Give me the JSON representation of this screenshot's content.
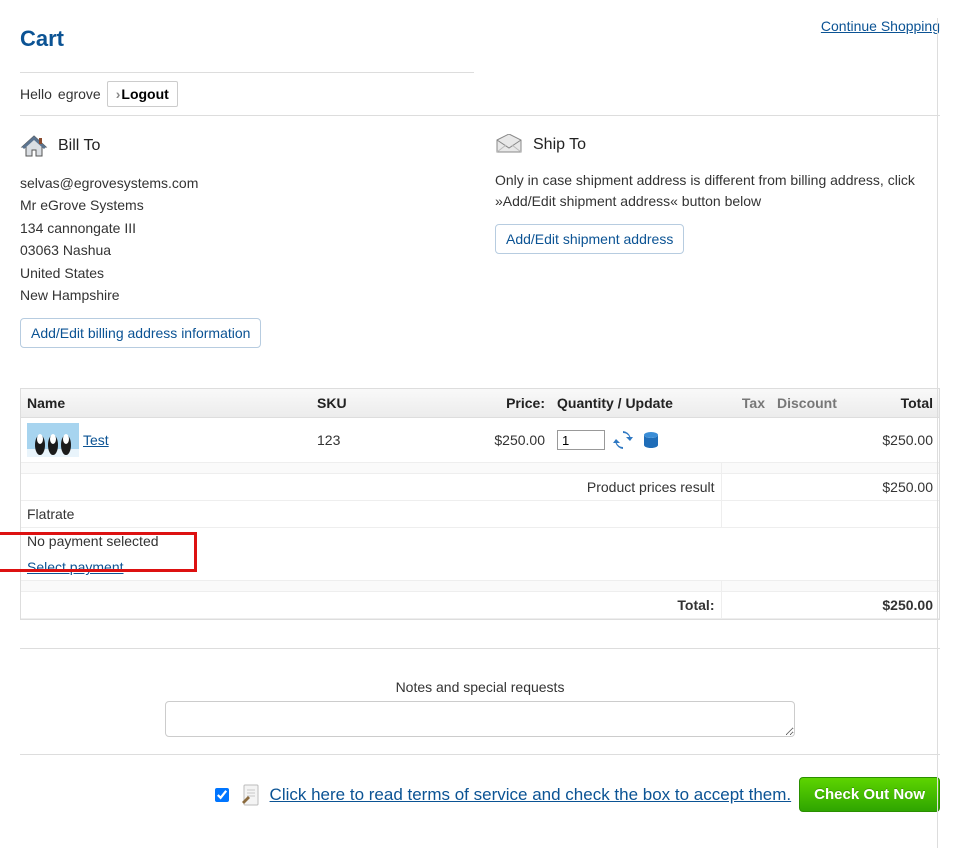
{
  "header": {
    "title": "Cart",
    "continue_link": "Continue Shopping",
    "greeting_prefix": "Hello ",
    "username": "egrove",
    "logout_label": "Logout"
  },
  "bill_to": {
    "heading": "Bill To",
    "email": "selvas@egrovesystems.com",
    "name": "Mr eGrove Systems",
    "street": "134 cannongate III",
    "city_zip": "03063 Nashua",
    "country": "United States",
    "region": "New Hampshire",
    "edit_label": "Add/Edit billing address information"
  },
  "ship_to": {
    "heading": "Ship To",
    "note": "Only in case shipment address is different from billing address, click »Add/Edit shipment address« button below",
    "edit_label": "Add/Edit shipment address"
  },
  "table": {
    "headers": {
      "name": "Name",
      "sku": "SKU",
      "price": "Price:",
      "qty": "Quantity / Update",
      "tax": "Tax",
      "discount": "Discount",
      "total": "Total"
    },
    "item": {
      "name": "Test",
      "sku": "123",
      "price": "$250.00",
      "qty_value": "1",
      "total": "$250.00"
    },
    "product_prices_result_label": "Product prices result",
    "product_prices_result_value": "$250.00",
    "shipping_label": "Flatrate",
    "payment_none": "No payment selected",
    "select_payment_link": "Select payment",
    "grand_total_label": "Total:",
    "grand_total_value": "$250.00"
  },
  "notes": {
    "heading": "Notes and special requests"
  },
  "footer": {
    "tos_link": " Click here to read terms of service and check the box to accept them.",
    "checkout_label": "Check Out Now"
  }
}
